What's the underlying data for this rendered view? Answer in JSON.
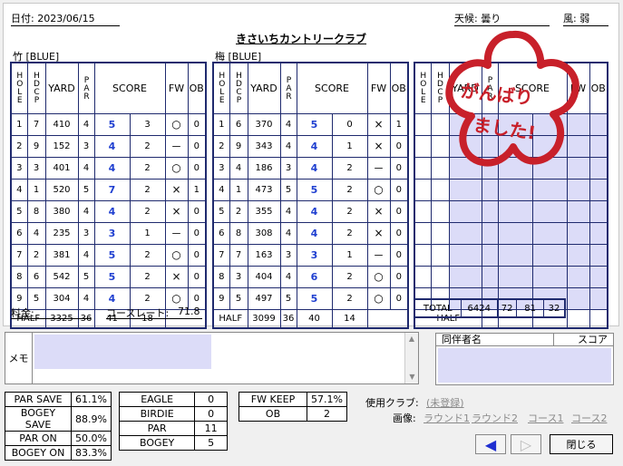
{
  "header": {
    "date_label": "日付: 2023/06/15",
    "weather_label": "天候: 曇り",
    "wind_label": "風: 弱",
    "course_title": "きさいちカントリークラブ"
  },
  "nine1": {
    "title": "竹 [BLUE]",
    "half_label": "HALF",
    "half_yard": "3325",
    "half_par": "36",
    "half_score": "41",
    "half_putt": "18",
    "rows": [
      [
        "1",
        "7",
        "410",
        "4",
        "5",
        "3",
        "○",
        "0"
      ],
      [
        "2",
        "9",
        "152",
        "3",
        "4",
        "2",
        "－",
        "0"
      ],
      [
        "3",
        "3",
        "401",
        "4",
        "4",
        "2",
        "○",
        "0"
      ],
      [
        "4",
        "1",
        "520",
        "5",
        "7",
        "2",
        "×",
        "1"
      ],
      [
        "5",
        "8",
        "380",
        "4",
        "4",
        "2",
        "×",
        "0"
      ],
      [
        "6",
        "4",
        "235",
        "3",
        "3",
        "1",
        "－",
        "0"
      ],
      [
        "7",
        "2",
        "381",
        "4",
        "5",
        "2",
        "○",
        "0"
      ],
      [
        "8",
        "6",
        "542",
        "5",
        "5",
        "2",
        "×",
        "0"
      ],
      [
        "9",
        "5",
        "304",
        "4",
        "4",
        "2",
        "○",
        "0"
      ]
    ]
  },
  "nine2": {
    "title": "梅 [BLUE]",
    "half_label": "HALF",
    "half_yard": "3099",
    "half_par": "36",
    "half_score": "40",
    "half_putt": "14",
    "rows": [
      [
        "1",
        "6",
        "370",
        "4",
        "5",
        "0",
        "×",
        "1"
      ],
      [
        "2",
        "9",
        "343",
        "4",
        "4",
        "1",
        "×",
        "0"
      ],
      [
        "3",
        "4",
        "186",
        "3",
        "4",
        "2",
        "－",
        "0"
      ],
      [
        "4",
        "1",
        "473",
        "5",
        "5",
        "2",
        "○",
        "0"
      ],
      [
        "5",
        "2",
        "355",
        "4",
        "4",
        "2",
        "×",
        "0"
      ],
      [
        "6",
        "8",
        "308",
        "4",
        "4",
        "2",
        "×",
        "0"
      ],
      [
        "7",
        "7",
        "163",
        "3",
        "3",
        "1",
        "－",
        "0"
      ],
      [
        "8",
        "3",
        "404",
        "4",
        "6",
        "2",
        "○",
        "0"
      ],
      [
        "9",
        "5",
        "497",
        "5",
        "5",
        "2",
        "○",
        "0"
      ]
    ]
  },
  "headers": {
    "hole": "HOLE",
    "hdcp": "HDCP",
    "yard": "YARD",
    "par": "PAR",
    "score": "SCORE",
    "fw": "FW",
    "ob": "OB"
  },
  "nine3": {
    "half_label": "HALF"
  },
  "total": {
    "label": "TOTAL",
    "yard": "6424",
    "par": "72",
    "score": "81",
    "putt": "32"
  },
  "stamp": {
    "line1": "がんばり",
    "line2": "ました!",
    "color": "#c8202a"
  },
  "fee_label": "料金:",
  "course_rate_label": "コースレート:",
  "course_rate_value": "71.8",
  "memo_label": "メモ",
  "companions": {
    "col1": "同伴者名",
    "col2": "スコア"
  },
  "stats": {
    "left": [
      [
        "PAR SAVE",
        "61.1%"
      ],
      [
        "BOGEY SAVE",
        "88.9%"
      ],
      [
        "PAR ON",
        "50.0%"
      ],
      [
        "BOGEY ON",
        "83.3%"
      ]
    ],
    "mid": [
      [
        "EAGLE",
        "0"
      ],
      [
        "BIRDIE",
        "0"
      ],
      [
        "PAR",
        "11"
      ],
      [
        "BOGEY",
        "5"
      ]
    ],
    "right": [
      [
        "FW KEEP",
        "57.1%"
      ],
      [
        "OB",
        "2"
      ]
    ]
  },
  "clubs_label": "使用クラブ:",
  "clubs_value": "(未登録)",
  "images_label": "画像:",
  "image_links": [
    "ラウンド1",
    "ラウンド2",
    "コース1",
    "コース2"
  ],
  "buttons": {
    "close": "閉じる"
  }
}
